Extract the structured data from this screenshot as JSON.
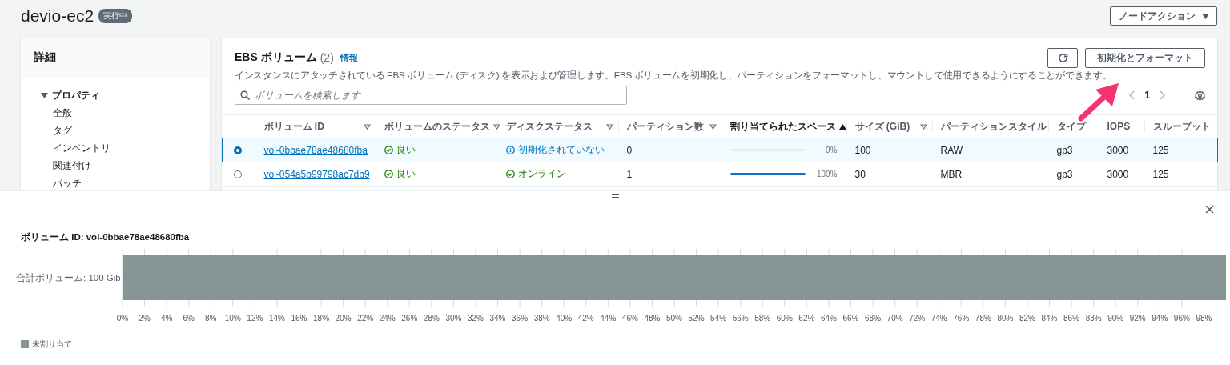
{
  "header": {
    "title": "devio-ec2",
    "status_badge": "実行中",
    "action_button": "ノードアクション"
  },
  "sidebar": {
    "title": "詳細",
    "tree": [
      {
        "label": "プロパティ",
        "expanded": true,
        "children": [
          {
            "label": "全般"
          },
          {
            "label": "タグ"
          },
          {
            "label": "インベントリ"
          },
          {
            "label": "関連付け"
          },
          {
            "label": "パッチ"
          }
        ]
      }
    ]
  },
  "volumes": {
    "title": "EBS ボリューム",
    "count": "(2)",
    "info_link": "情報",
    "description": "インスタンスにアタッチされている EBS ボリューム (ディスク) を表示および管理します。EBS ボリュームを初期化し、パーティションをフォーマットし、マウントして使用できるようにすることができます。",
    "format_button": "初期化とフォーマット",
    "search": {
      "placeholder": "ボリュームを検索します"
    },
    "page": "1",
    "columns": [
      {
        "label": "ボリューム ID",
        "sortable": true,
        "sorted": false
      },
      {
        "label": "ボリュームのステータス",
        "sortable": true,
        "sorted": false
      },
      {
        "label": "ディスクステータス",
        "sortable": true,
        "sorted": false
      },
      {
        "label": "パーティション数",
        "sortable": true,
        "sorted": false
      },
      {
        "label": "割り当てられたスペース",
        "sortable": true,
        "sorted": true
      },
      {
        "label": "サイズ (GiB)",
        "sortable": true,
        "sorted": false
      },
      {
        "label": "パーティションスタイル",
        "sortable": false,
        "sorted": false
      },
      {
        "label": "タイプ",
        "sortable": false,
        "sorted": false
      },
      {
        "label": "IOPS",
        "sortable": false,
        "sorted": false
      },
      {
        "label": "スループット",
        "sortable": false,
        "sorted": false
      }
    ],
    "rows": [
      {
        "selected": true,
        "volume_id": "vol-0bbae78ae48680fba",
        "volume_status": "良い",
        "disk_status": {
          "kind": "info",
          "text": "初期化されていない"
        },
        "partitions": "0",
        "allocated": {
          "level": 0,
          "reading": "0%"
        },
        "size": "100",
        "partition_style": "RAW",
        "type": "gp3",
        "iops": "3000",
        "throughput": "125"
      },
      {
        "selected": false,
        "volume_id": "vol-054a5b99798ac7db9",
        "volume_status": "良い",
        "disk_status": {
          "kind": "success",
          "text": "オンライン"
        },
        "partitions": "1",
        "allocated": {
          "level": 1,
          "reading": "100%"
        },
        "size": "30",
        "partition_style": "MBR",
        "type": "gp3",
        "iops": "3000",
        "throughput": "125"
      }
    ]
  },
  "detail": {
    "title": "ボリューム ID: vol-0bbae78ae48680fba",
    "chart_data": {
      "type": "bar",
      "orientation": "horizontal",
      "stacked": true,
      "grid": true,
      "categories": [
        "合計ボリューム: 100 Gib"
      ],
      "series": [
        {
          "name": "未割り当て",
          "color": "#879596",
          "values": [
            100
          ]
        }
      ],
      "xlim": [
        0,
        100
      ],
      "xticks": [
        {
          "value": 0,
          "label": "0%"
        },
        {
          "value": 2,
          "label": "2%"
        },
        {
          "value": 4,
          "label": "4%"
        },
        {
          "value": 6,
          "label": "6%"
        },
        {
          "value": 8,
          "label": "8%"
        },
        {
          "value": 10,
          "label": "10%"
        },
        {
          "value": 12,
          "label": "12%"
        },
        {
          "value": 14,
          "label": "14%"
        },
        {
          "value": 16,
          "label": "16%"
        },
        {
          "value": 18,
          "label": "18%"
        },
        {
          "value": 20,
          "label": "20%"
        },
        {
          "value": 22,
          "label": "22%"
        },
        {
          "value": 24,
          "label": "24%"
        },
        {
          "value": 26,
          "label": "26%"
        },
        {
          "value": 28,
          "label": "28%"
        },
        {
          "value": 30,
          "label": "30%"
        },
        {
          "value": 32,
          "label": "32%"
        },
        {
          "value": 34,
          "label": "34%"
        },
        {
          "value": 36,
          "label": "36%"
        },
        {
          "value": 38,
          "label": "38%"
        },
        {
          "value": 40,
          "label": "40%"
        },
        {
          "value": 42,
          "label": "42%"
        },
        {
          "value": 44,
          "label": "44%"
        },
        {
          "value": 46,
          "label": "46%"
        },
        {
          "value": 48,
          "label": "48%"
        },
        {
          "value": 50,
          "label": "50%"
        },
        {
          "value": 52,
          "label": "52%"
        },
        {
          "value": 54,
          "label": "54%"
        },
        {
          "value": 56,
          "label": "56%"
        },
        {
          "value": 58,
          "label": "58%"
        },
        {
          "value": 60,
          "label": "60%"
        },
        {
          "value": 62,
          "label": "62%"
        },
        {
          "value": 64,
          "label": "64%"
        },
        {
          "value": 66,
          "label": "66%"
        },
        {
          "value": 68,
          "label": "68%"
        },
        {
          "value": 70,
          "label": "70%"
        },
        {
          "value": 72,
          "label": "72%"
        },
        {
          "value": 74,
          "label": "74%"
        },
        {
          "value": 76,
          "label": "76%"
        },
        {
          "value": 78,
          "label": "78%"
        },
        {
          "value": 80,
          "label": "80%"
        },
        {
          "value": 82,
          "label": "82%"
        },
        {
          "value": 84,
          "label": "84%"
        },
        {
          "value": 86,
          "label": "86%"
        },
        {
          "value": 88,
          "label": "88%"
        },
        {
          "value": 90,
          "label": "90%"
        },
        {
          "value": 92,
          "label": "92%"
        },
        {
          "value": 94,
          "label": "94%"
        },
        {
          "value": 96,
          "label": "96%"
        },
        {
          "value": 98,
          "label": "98%"
        }
      ]
    }
  }
}
